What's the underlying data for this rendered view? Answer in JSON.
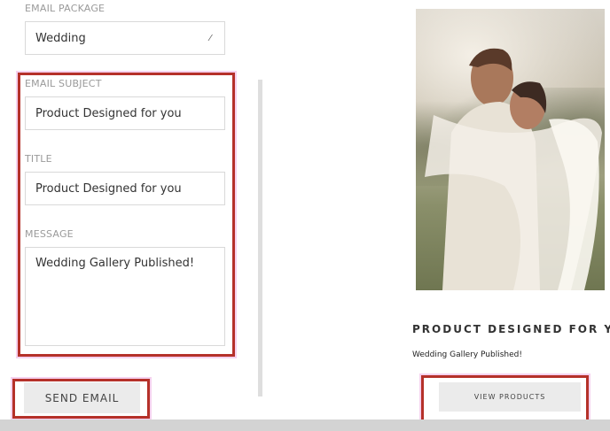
{
  "form": {
    "package_label": "EMAIL PACKAGE",
    "package_value": "Wedding",
    "subject_label": "EMAIL SUBJECT",
    "subject_value": "Product Designed for you",
    "title_label": "TITLE",
    "title_value": "Product Designed for you",
    "message_label": "MESSAGE",
    "message_value": "Wedding Gallery Published!",
    "send_button": "SEND EMAIL"
  },
  "preview": {
    "heading": "PRODUCT DESIGNED FOR YOU",
    "message": "Wedding Gallery Published!",
    "cta_button": "VIEW PRODUCTS"
  },
  "colors": {
    "highlight": "#b5312a",
    "button_bg": "#ebebeb"
  },
  "icons": {
    "select_arrow": "edit-caret-icon"
  }
}
